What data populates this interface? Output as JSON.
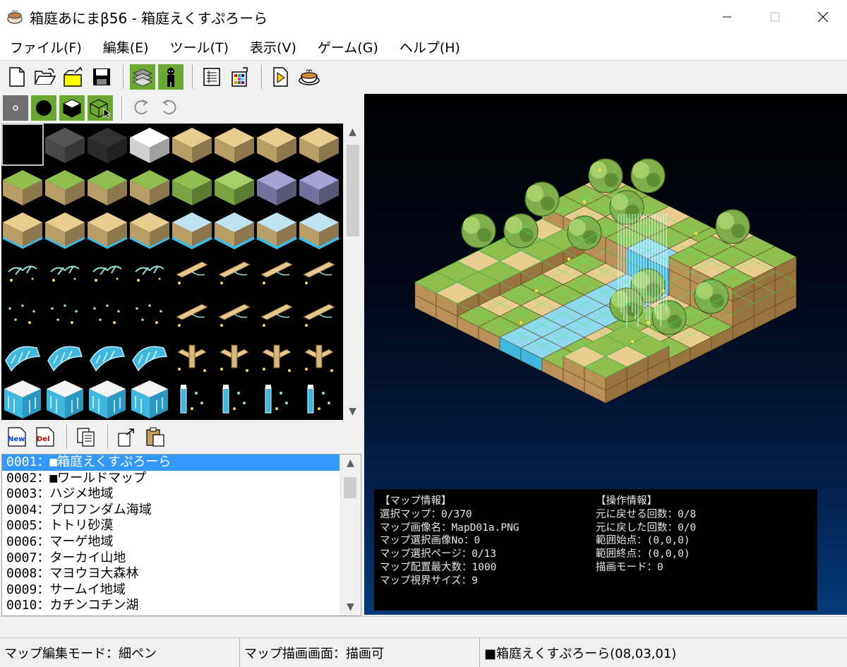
{
  "window": {
    "title": "箱庭あにまβ56 - 箱庭えくすぷろーら",
    "icon": "teacup-app-icon"
  },
  "menu": [
    "ファイル(F)",
    "編集(E)",
    "ツール(T)",
    "表示(V)",
    "ゲーム(G)",
    "ヘルプ(H)"
  ],
  "toolbar": {
    "buttons": [
      "new-file-icon",
      "open-folder-icon",
      "open-project-icon",
      "save-icon",
      "layer-map-icon",
      "character-icon",
      "list-icon",
      "palette-icon",
      "play-icon",
      "teacup-icon"
    ]
  },
  "tile_toolbar": {
    "buttons": [
      "point-pen-icon",
      "circle-pen-icon",
      "block-icon",
      "block-select-icon",
      "undo-icon",
      "redo-icon"
    ]
  },
  "list_toolbar": {
    "new_label": "New",
    "del_label": "Del"
  },
  "maps": [
    {
      "id": "0001",
      "name": "■箱庭えくすぷろーら"
    },
    {
      "id": "0002",
      "name": "■ワールドマップ"
    },
    {
      "id": "0003",
      "name": "ハジメ地域"
    },
    {
      "id": "0004",
      "name": "プロフンダム海域"
    },
    {
      "id": "0005",
      "name": "トトリ砂漠"
    },
    {
      "id": "0006",
      "name": "マーゲ地域"
    },
    {
      "id": "0007",
      "name": "ターカイ山地"
    },
    {
      "id": "0008",
      "name": "マヨウヨ大森林"
    },
    {
      "id": "0009",
      "name": "サームイ地域"
    },
    {
      "id": "0010",
      "name": "カチンコチン湖"
    }
  ],
  "map_info": {
    "left": [
      "【マップ情報】",
      "選択マップ：0/370",
      "マップ画像名：MapD01a.PNG",
      "マップ選択画像No：0",
      "マップ選択ページ：0/13",
      "マップ配置最大数：1000",
      "マップ視界サイズ：9"
    ],
    "right": [
      "【操作情報】",
      "元に戻せる回数：0/8",
      "元に戻した回数：0/0",
      "範囲始点：(0,0,0)",
      "範囲終点：(0,0,0)",
      "描画モード：0"
    ]
  },
  "status": {
    "edit_mode": "マップ編集モード：細ペン",
    "draw_screen": "マップ描画画面：描画可",
    "current_map": "■箱庭えくすぷろーら(08,03,01)"
  },
  "colors": {
    "selection": "#3399ff",
    "tile_highlight": "#6aa832",
    "grid": "#33ff66"
  }
}
